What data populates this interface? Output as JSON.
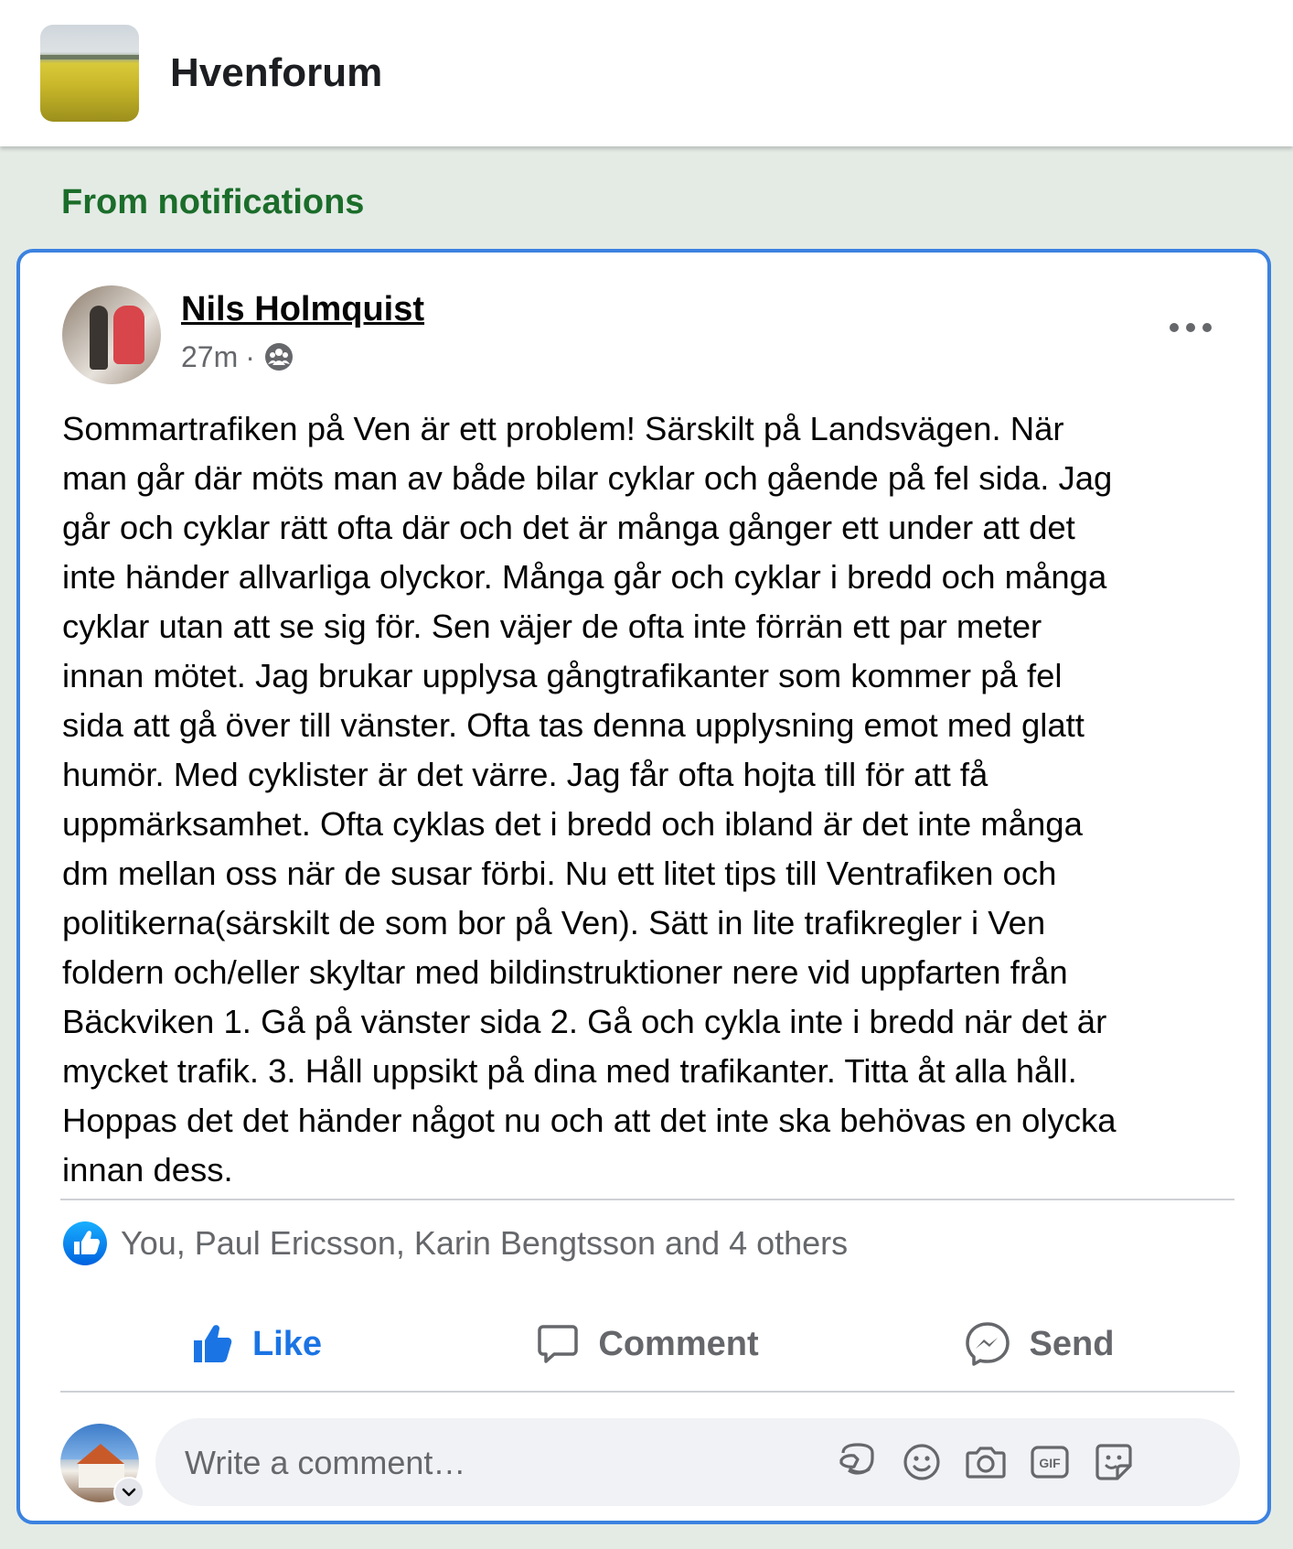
{
  "header": {
    "group_name": "Hvenforum",
    "group_thumb_icon": "rapeseed-field-thumbnail"
  },
  "section_label": "From notifications",
  "post": {
    "author": "Nils Holmquist",
    "time": "27m",
    "separator": "·",
    "audience_icon": "group-members-icon",
    "more_icon": "more-options-icon",
    "text": "Sommartrafiken på Ven är ett problem! Särskilt på Landsvägen. När\nman går där möts man av både bilar cyklar och gående på fel sida. Jag\ngår och cyklar rätt ofta där och det är många gånger ett under att det\ninte händer allvarliga olyckor. Många går och cyklar i bredd och många\ncyklar utan att se sig för. Sen väjer de ofta inte förrän ett par meter\ninnan mötet. Jag brukar upplysa gångtrafikanter som kommer på fel\nsida att gå över till vänster. Ofta tas denna upplysning emot med glatt\nhumör. Med cyklister är det värre. Jag får ofta hojta till för att få\nuppmärksamhet. Ofta cyklas det i bredd och ibland är det inte många\ndm mellan oss när de susar förbi. Nu ett litet tips till Ventrafiken och\npolitikerna(särskilt de som bor på Ven). Sätt in lite trafikregler i Ven\nfoldern och/eller skyltar med bildinstruktioner nere vid uppfarten från\nBäckviken  1. Gå på vänster sida 2. Gå och cykla inte i bredd när det är\nmycket trafik. 3. Håll uppsikt på dina med trafikanter. Titta åt alla håll.\nHoppas det det händer något nu och att det inte ska behövas en olycka\ninnan dess.",
    "reactions_text": "You, Paul Ericsson, Karin Bengtsson and 4 others",
    "actions": {
      "like": "Like",
      "comment": "Comment",
      "send": "Send"
    },
    "like_active": true,
    "comment_placeholder": "Write a comment…",
    "comment_tools": [
      "avatar-sticker-icon",
      "emoji-icon",
      "camera-icon",
      "gif-icon",
      "sticker-icon"
    ]
  },
  "colors": {
    "accent_blue": "#1b74e4",
    "section_green": "#1b6d2a",
    "card_border": "#3b82e0",
    "page_bg": "#e4ebe5"
  }
}
